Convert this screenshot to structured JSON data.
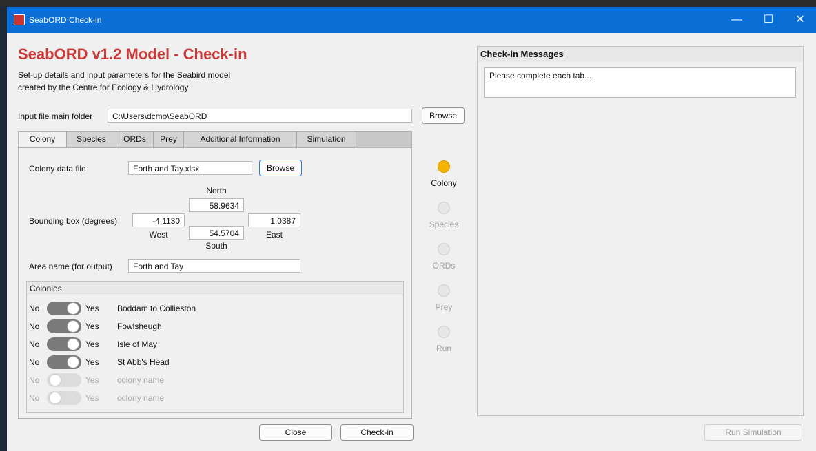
{
  "window": {
    "title": "SeabORD Check-in",
    "minimize_glyph": "—",
    "maximize_glyph": "☐",
    "close_glyph": "✕"
  },
  "header": {
    "title": "SeabORD v1.2 Model - Check-in",
    "description_line1": "Set-up details and input parameters for the Seabird model",
    "description_line2": "created by the Centre for Ecology & Hydrology"
  },
  "input_folder": {
    "label": "Input file main folder",
    "value": "C:\\Users\\dcmo\\SeabORD",
    "browse_label": "Browse"
  },
  "tabs": [
    {
      "label": "Colony",
      "active": true
    },
    {
      "label": "Species",
      "active": false
    },
    {
      "label": "ORDs",
      "active": false
    },
    {
      "label": "Prey",
      "active": false
    },
    {
      "label": "Additional Information",
      "active": false
    },
    {
      "label": "Simulation",
      "active": false
    }
  ],
  "colony_tab": {
    "data_file_label": "Colony data file",
    "data_file_value": "Forth and Tay.xlsx",
    "browse_label": "Browse",
    "bbox_label": "Bounding box (degrees)",
    "north_label": "North",
    "north_value": "58.9634",
    "west_value": "-4.1130",
    "west_label": "West",
    "south_value": "54.5704",
    "south_label": "South",
    "east_value": "1.0387",
    "east_label": "East",
    "area_label": "Area name (for output)",
    "area_value": "Forth and Tay"
  },
  "colonies": {
    "header": "Colonies",
    "no_label": "No",
    "yes_label": "Yes",
    "items": [
      {
        "name": "Boddam to Collieston",
        "enabled": true
      },
      {
        "name": "Fowlsheugh",
        "enabled": true
      },
      {
        "name": "Isle of May",
        "enabled": true
      },
      {
        "name": "St Abb's Head",
        "enabled": true
      },
      {
        "name": "colony name",
        "enabled": false
      },
      {
        "name": "colony name",
        "enabled": false
      }
    ]
  },
  "progress": [
    {
      "label": "Colony",
      "status": "active",
      "color": "#f5b400"
    },
    {
      "label": "Species",
      "status": "pending",
      "color": "#e6e6e6"
    },
    {
      "label": "ORDs",
      "status": "pending",
      "color": "#e6e6e6"
    },
    {
      "label": "Prey",
      "status": "pending",
      "color": "#e6e6e6"
    },
    {
      "label": "Run",
      "status": "pending",
      "color": "#e6e6e6"
    }
  ],
  "messages": {
    "header": "Check-in Messages",
    "text": "Please complete each tab..."
  },
  "buttons": {
    "close_label": "Close",
    "checkin_label": "Check-in",
    "run_label": "Run Simulation"
  },
  "colors": {
    "title_red": "#c93a38",
    "titlebar_blue": "#0a6ed6",
    "lamp_active": "#f5b400"
  }
}
